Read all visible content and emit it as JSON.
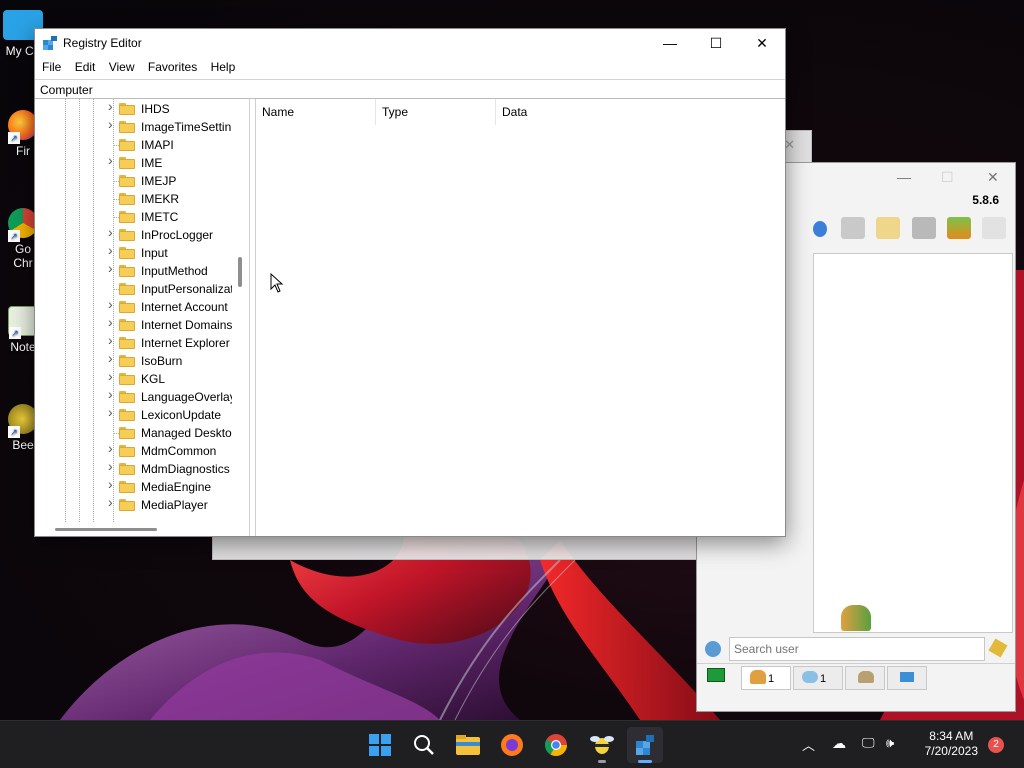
{
  "desktop": {
    "icons": [
      {
        "label": "My Co",
        "icon": "computer-icon"
      },
      {
        "label": "Fir",
        "icon": "firefox-icon"
      },
      {
        "label": "Go\nChr",
        "icon": "chrome-icon"
      },
      {
        "label": "Note",
        "icon": "notepad-icon"
      },
      {
        "label": "Bee",
        "icon": "beebeep-icon"
      }
    ]
  },
  "chat_app": {
    "version": "5.8.6",
    "search_placeholder": "Search user",
    "tabs": [
      {
        "icon": "users-icon",
        "count": "1"
      },
      {
        "icon": "chat-bubbles-icon",
        "count": "1"
      },
      {
        "icon": "groups-icon",
        "count": ""
      },
      {
        "icon": "network-icon",
        "count": ""
      }
    ]
  },
  "regedit": {
    "title": "Registry Editor",
    "window_controls": {
      "minimize": "—",
      "maximize": "☐",
      "close": "✕"
    },
    "menu": [
      "File",
      "Edit",
      "View",
      "Favorites",
      "Help"
    ],
    "address": "Computer",
    "tree": [
      {
        "label": "IHDS",
        "expandable": true
      },
      {
        "label": "ImageTimeSettin",
        "expandable": true
      },
      {
        "label": "IMAPI",
        "expandable": false
      },
      {
        "label": "IME",
        "expandable": true
      },
      {
        "label": "IMEJP",
        "expandable": false
      },
      {
        "label": "IMEKR",
        "expandable": false
      },
      {
        "label": "IMETC",
        "expandable": false
      },
      {
        "label": "InProcLogger",
        "expandable": true
      },
      {
        "label": "Input",
        "expandable": true
      },
      {
        "label": "InputMethod",
        "expandable": true
      },
      {
        "label": "InputPersonalizat",
        "expandable": false
      },
      {
        "label": "Internet Account",
        "expandable": true
      },
      {
        "label": "Internet Domains",
        "expandable": true
      },
      {
        "label": "Internet Explorer",
        "expandable": true
      },
      {
        "label": "IsoBurn",
        "expandable": true
      },
      {
        "label": "KGL",
        "expandable": true
      },
      {
        "label": "LanguageOverlay",
        "expandable": true
      },
      {
        "label": "LexiconUpdate",
        "expandable": true
      },
      {
        "label": "Managed Desktop",
        "expandable": false
      },
      {
        "label": "MdmCommon",
        "expandable": true
      },
      {
        "label": "MdmDiagnostics",
        "expandable": true
      },
      {
        "label": "MediaEngine",
        "expandable": true
      },
      {
        "label": "MediaPlayer",
        "expandable": true
      }
    ],
    "columns": [
      "Name",
      "Type",
      "Data"
    ]
  },
  "taskbar": {
    "apps": [
      {
        "icon": "windows-start-icon",
        "active": false,
        "running": false
      },
      {
        "icon": "search-icon",
        "active": false,
        "running": false
      },
      {
        "icon": "file-explorer-icon",
        "active": false,
        "running": false
      },
      {
        "icon": "firefox-icon",
        "active": false,
        "running": false
      },
      {
        "icon": "chrome-icon",
        "active": false,
        "running": false
      },
      {
        "icon": "beebeep-icon",
        "active": false,
        "running": true
      },
      {
        "icon": "registry-editor-icon",
        "active": true,
        "running": true
      }
    ],
    "time": "8:34 AM",
    "date": "7/20/2023",
    "notifications": "2"
  }
}
